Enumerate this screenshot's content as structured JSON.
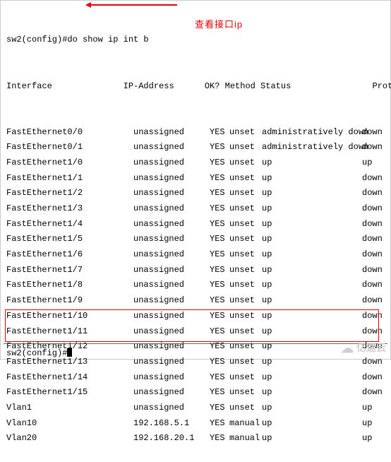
{
  "prompt_line": "sw2(config)#do show ip int b",
  "header_wrap": "Interface              IP-Address      OK? Method Status                Protocol",
  "annotation_text": "查看接口ip",
  "prompt2": "sw2(config)#",
  "watermark": "亿速云",
  "cols": {
    "interface": "Interface",
    "ip": "IP-Address",
    "ok": "OK?",
    "method": "Method",
    "status": "Status",
    "protocol": "Protocol"
  },
  "rows": [
    {
      "if": "FastEthernet0/0",
      "ip": "unassigned",
      "ok": "YES",
      "mt": "unset",
      "st": "administratively down",
      "pr": "down"
    },
    {
      "if": "FastEthernet0/1",
      "ip": "unassigned",
      "ok": "YES",
      "mt": "unset",
      "st": "administratively down",
      "pr": "down"
    },
    {
      "if": "FastEthernet1/0",
      "ip": "unassigned",
      "ok": "YES",
      "mt": "unset",
      "st": "up",
      "pr": "up"
    },
    {
      "if": "FastEthernet1/1",
      "ip": "unassigned",
      "ok": "YES",
      "mt": "unset",
      "st": "up",
      "pr": "down"
    },
    {
      "if": "FastEthernet1/2",
      "ip": "unassigned",
      "ok": "YES",
      "mt": "unset",
      "st": "up",
      "pr": "down"
    },
    {
      "if": "FastEthernet1/3",
      "ip": "unassigned",
      "ok": "YES",
      "mt": "unset",
      "st": "up",
      "pr": "down"
    },
    {
      "if": "FastEthernet1/4",
      "ip": "unassigned",
      "ok": "YES",
      "mt": "unset",
      "st": "up",
      "pr": "down"
    },
    {
      "if": "FastEthernet1/5",
      "ip": "unassigned",
      "ok": "YES",
      "mt": "unset",
      "st": "up",
      "pr": "down"
    },
    {
      "if": "FastEthernet1/6",
      "ip": "unassigned",
      "ok": "YES",
      "mt": "unset",
      "st": "up",
      "pr": "down"
    },
    {
      "if": "FastEthernet1/7",
      "ip": "unassigned",
      "ok": "YES",
      "mt": "unset",
      "st": "up",
      "pr": "down"
    },
    {
      "if": "FastEthernet1/8",
      "ip": "unassigned",
      "ok": "YES",
      "mt": "unset",
      "st": "up",
      "pr": "down"
    },
    {
      "if": "FastEthernet1/9",
      "ip": "unassigned",
      "ok": "YES",
      "mt": "unset",
      "st": "up",
      "pr": "down"
    },
    {
      "if": "FastEthernet1/10",
      "ip": "unassigned",
      "ok": "YES",
      "mt": "unset",
      "st": "up",
      "pr": "down"
    },
    {
      "if": "FastEthernet1/11",
      "ip": "unassigned",
      "ok": "YES",
      "mt": "unset",
      "st": "up",
      "pr": "down"
    },
    {
      "if": "FastEthernet1/12",
      "ip": "unassigned",
      "ok": "YES",
      "mt": "unset",
      "st": "up",
      "pr": "down"
    },
    {
      "if": "FastEthernet1/13",
      "ip": "unassigned",
      "ok": "YES",
      "mt": "unset",
      "st": "up",
      "pr": "down"
    },
    {
      "if": "FastEthernet1/14",
      "ip": "unassigned",
      "ok": "YES",
      "mt": "unset",
      "st": "up",
      "pr": "down"
    },
    {
      "if": "FastEthernet1/15",
      "ip": "unassigned",
      "ok": "YES",
      "mt": "unset",
      "st": "up",
      "pr": "down"
    },
    {
      "if": "Vlan1",
      "ip": "unassigned",
      "ok": "YES",
      "mt": "unset",
      "st": "up",
      "pr": "up"
    },
    {
      "if": "Vlan10",
      "ip": "192.168.5.1",
      "ok": "YES",
      "mt": "manual",
      "st": "up",
      "pr": "up"
    },
    {
      "if": "Vlan20",
      "ip": "192.168.20.1",
      "ok": "YES",
      "mt": "manual",
      "st": "up",
      "pr": "up"
    }
  ]
}
